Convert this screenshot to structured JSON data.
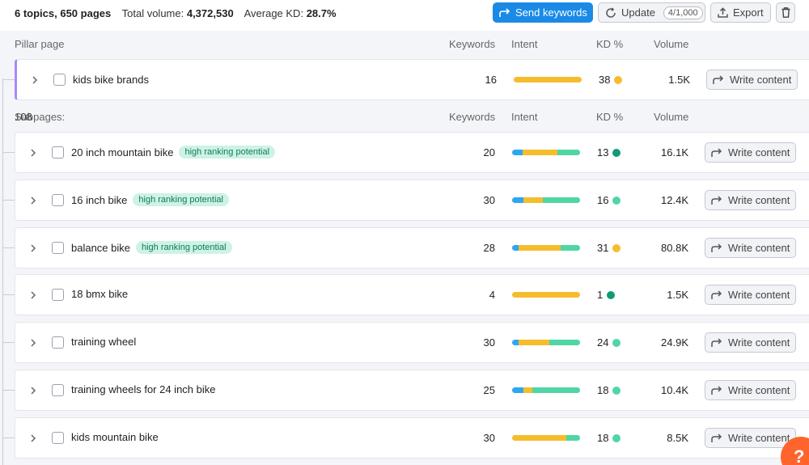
{
  "summary": {
    "topics_pages": "6 topics, 650 pages",
    "volume_label": "Total volume:",
    "volume_value": "4,372,530",
    "kd_label": "Average KD:",
    "kd_value": "28.7%"
  },
  "toolbar": {
    "send_label": "Send keywords",
    "update_label": "Update",
    "update_count": "4/1,000",
    "export_label": "Export"
  },
  "pillar_header": {
    "title": "Pillar page",
    "keywords": "Keywords",
    "intent": "Intent",
    "kd": "KD %",
    "volume": "Volume"
  },
  "pillar": {
    "keyword": "kids bike brands",
    "keywords": "16",
    "kd": "38",
    "volume": "1.5K",
    "kd_color": "#f5bd2e",
    "intent": [
      {
        "color": "#f5bd2e",
        "pct": 100
      }
    ]
  },
  "subpages_header": {
    "label": "Subpages:",
    "count": "108",
    "keywords": "Keywords",
    "intent": "Intent",
    "kd": "KD %",
    "volume": "Volume"
  },
  "write_label": "Write content",
  "subpages": [
    {
      "keyword": "20 inch mountain bike",
      "tag": "high ranking potential",
      "keywords": "20",
      "kd": "13",
      "kd_color": "#109b75",
      "volume": "16.1K",
      "intent": [
        {
          "color": "#2fa6f0",
          "pct": 16
        },
        {
          "color": "#f5bd2e",
          "pct": 51
        },
        {
          "color": "#4fd6a4",
          "pct": 33
        }
      ]
    },
    {
      "keyword": "16 inch bike",
      "tag": "high ranking potential",
      "keywords": "30",
      "kd": "16",
      "kd_color": "#4fd6a4",
      "volume": "12.4K",
      "intent": [
        {
          "color": "#2fa6f0",
          "pct": 17
        },
        {
          "color": "#f5bd2e",
          "pct": 28
        },
        {
          "color": "#4fd6a4",
          "pct": 55
        }
      ]
    },
    {
      "keyword": "balance bike",
      "tag": "high ranking potential",
      "keywords": "28",
      "kd": "31",
      "kd_color": "#f5bd2e",
      "volume": "80.8K",
      "intent": [
        {
          "color": "#2fa6f0",
          "pct": 9
        },
        {
          "color": "#f5bd2e",
          "pct": 62
        },
        {
          "color": "#4fd6a4",
          "pct": 29
        }
      ]
    },
    {
      "keyword": "18 bmx bike",
      "tag": "",
      "keywords": "4",
      "kd": "1",
      "kd_color": "#109b75",
      "volume": "1.5K",
      "intent": [
        {
          "color": "#f5bd2e",
          "pct": 100
        }
      ]
    },
    {
      "keyword": "training wheel",
      "tag": "",
      "keywords": "30",
      "kd": "24",
      "kd_color": "#4fd6a4",
      "volume": "24.9K",
      "intent": [
        {
          "color": "#2fa6f0",
          "pct": 10
        },
        {
          "color": "#f5bd2e",
          "pct": 45
        },
        {
          "color": "#4fd6a4",
          "pct": 45
        }
      ]
    },
    {
      "keyword": "training wheels for 24 inch bike",
      "tag": "",
      "keywords": "25",
      "kd": "18",
      "kd_color": "#4fd6a4",
      "volume": "10.4K",
      "intent": [
        {
          "color": "#2fa6f0",
          "pct": 17
        },
        {
          "color": "#f5bd2e",
          "pct": 13
        },
        {
          "color": "#4fd6a4",
          "pct": 70
        }
      ]
    },
    {
      "keyword": "kids mountain bike",
      "tag": "",
      "keywords": "30",
      "kd": "18",
      "kd_color": "#4fd6a4",
      "volume": "8.5K",
      "intent": [
        {
          "color": "#f5bd2e",
          "pct": 80
        },
        {
          "color": "#4fd6a4",
          "pct": 20
        }
      ]
    }
  ],
  "help_label": "?",
  "colors": {
    "accent": "#1a8ae6",
    "pillar_bar": "#a78bfa",
    "tag_bg": "#cdf2e6",
    "help": "#ff642d"
  }
}
